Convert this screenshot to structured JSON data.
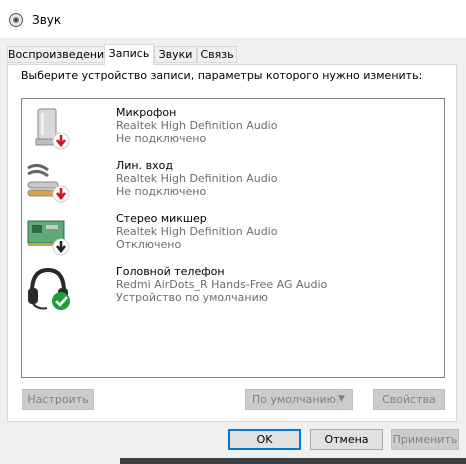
{
  "window": {
    "title": "Звук"
  },
  "tabs": [
    {
      "label": "Воспроизведение"
    },
    {
      "label": "Запись"
    },
    {
      "label": "Звуки"
    },
    {
      "label": "Связь"
    }
  ],
  "main": {
    "instruction": "Выберите устройство записи, параметры которого нужно изменить:",
    "devices": [
      {
        "name": "Микрофон",
        "driver": "Realtek High Definition Audio",
        "status": "Не подключено",
        "icon": "microphone-icon",
        "badge": "unplugged-badge-icon"
      },
      {
        "name": "Лин. вход",
        "driver": "Realtek High Definition Audio",
        "status": "Не подключено",
        "icon": "line-in-icon",
        "badge": "unplugged-badge-icon"
      },
      {
        "name": "Стерео микшер",
        "driver": "Realtek High Definition Audio",
        "status": "Отключено",
        "icon": "stereo-mixer-icon",
        "badge": "disabled-badge-icon"
      },
      {
        "name": "Головной телефон",
        "driver": "Redmi AirDots_R Hands-Free AG Audio",
        "status": "Устройство по умолчанию",
        "icon": "headset-icon",
        "badge": "default-check-badge-icon"
      }
    ],
    "buttons": {
      "configure": "Настроить",
      "set_default": "По умолчанию",
      "properties": "Свойства"
    }
  },
  "footer": {
    "ok": "OK",
    "cancel": "Отмена",
    "apply": "Применить"
  },
  "colors": {
    "accent": "#0078d7",
    "unplugged_badge": "#d6131a",
    "default_badge": "#1e9e3a"
  }
}
